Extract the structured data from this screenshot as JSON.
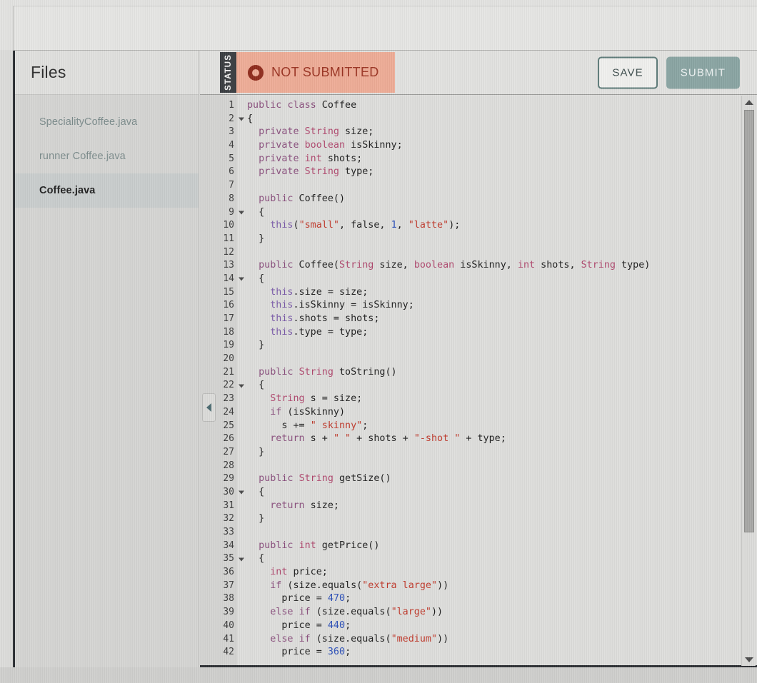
{
  "sidebar": {
    "title": "Files",
    "files": [
      {
        "name": "SpecialityCoffee.java",
        "active": false
      },
      {
        "name": "runner  Coffee.java",
        "active": false
      },
      {
        "name": "Coffee.java",
        "active": true
      }
    ]
  },
  "toolbar": {
    "status_tab_label": "STATUS",
    "status_text": "NOT SUBMITTED",
    "status_icon": "circle-ring-icon",
    "save_label": "SAVE",
    "submit_label": "SUBMIT",
    "status_bg_color": "#eeac96",
    "status_text_color": "#9b3322",
    "submit_bg_color": "#8aa5a3",
    "save_border_color": "#5c7a78"
  },
  "editor": {
    "language": "java",
    "first_visible_line": 1,
    "last_visible_line": 42,
    "fold_lines": [
      2,
      9,
      14,
      22,
      30,
      35
    ],
    "lines": [
      {
        "n": 1,
        "text": "public class Coffee"
      },
      {
        "n": 2,
        "text": "{"
      },
      {
        "n": 3,
        "text": "  private String size;"
      },
      {
        "n": 4,
        "text": "  private boolean isSkinny;"
      },
      {
        "n": 5,
        "text": "  private int shots;"
      },
      {
        "n": 6,
        "text": "  private String type;"
      },
      {
        "n": 7,
        "text": ""
      },
      {
        "n": 8,
        "text": "  public Coffee()"
      },
      {
        "n": 9,
        "text": "  {"
      },
      {
        "n": 10,
        "text": "    this(\"small\", false, 1, \"latte\");"
      },
      {
        "n": 11,
        "text": "  }"
      },
      {
        "n": 12,
        "text": ""
      },
      {
        "n": 13,
        "text": "  public Coffee(String size, boolean isSkinny, int shots, String type)"
      },
      {
        "n": 14,
        "text": "  {"
      },
      {
        "n": 15,
        "text": "    this.size = size;"
      },
      {
        "n": 16,
        "text": "    this.isSkinny = isSkinny;"
      },
      {
        "n": 17,
        "text": "    this.shots = shots;"
      },
      {
        "n": 18,
        "text": "    this.type = type;"
      },
      {
        "n": 19,
        "text": "  }"
      },
      {
        "n": 20,
        "text": ""
      },
      {
        "n": 21,
        "text": "  public String toString()"
      },
      {
        "n": 22,
        "text": "  {"
      },
      {
        "n": 23,
        "text": "    String s = size;"
      },
      {
        "n": 24,
        "text": "    if (isSkinny)"
      },
      {
        "n": 25,
        "text": "      s += \" skinny\";"
      },
      {
        "n": 26,
        "text": "    return s + \" \" + shots + \"-shot \" + type;"
      },
      {
        "n": 27,
        "text": "  }"
      },
      {
        "n": 28,
        "text": ""
      },
      {
        "n": 29,
        "text": "  public String getSize()"
      },
      {
        "n": 30,
        "text": "  {"
      },
      {
        "n": 31,
        "text": "    return size;"
      },
      {
        "n": 32,
        "text": "  }"
      },
      {
        "n": 33,
        "text": ""
      },
      {
        "n": 34,
        "text": "  public int getPrice()"
      },
      {
        "n": 35,
        "text": "  {"
      },
      {
        "n": 36,
        "text": "    int price;"
      },
      {
        "n": 37,
        "text": "    if (size.equals(\"extra large\"))"
      },
      {
        "n": 38,
        "text": "      price = 470;"
      },
      {
        "n": 39,
        "text": "    else if (size.equals(\"large\"))"
      },
      {
        "n": 40,
        "text": "      price = 440;"
      },
      {
        "n": 41,
        "text": "    else if (size.equals(\"medium\"))"
      },
      {
        "n": 42,
        "text": "      price = 360;"
      }
    ]
  },
  "controls": {
    "collapse_icon": "triangle-left-icon",
    "scroll_up_icon": "triangle-up-icon",
    "scroll_down_icon": "triangle-down-icon"
  }
}
